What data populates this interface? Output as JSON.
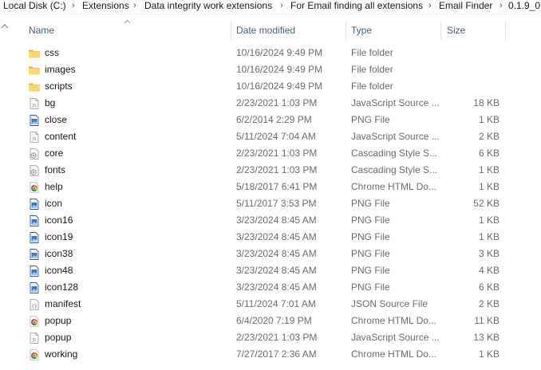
{
  "breadcrumb": {
    "items": [
      "Local Disk (C:)",
      "Extensions",
      "Data integrity work extensions",
      "For Email finding all extensions",
      "Email Finder",
      "0.1.9_0"
    ],
    "separator": "›"
  },
  "columns": {
    "name": "Name",
    "date": "Date modified",
    "type": "Type",
    "size": "Size"
  },
  "files": [
    {
      "name": "css",
      "date": "10/16/2024 9:49 PM",
      "type": "File folder",
      "size": "",
      "icon": "folder-icon"
    },
    {
      "name": "images",
      "date": "10/16/2024 9:49 PM",
      "type": "File folder",
      "size": "",
      "icon": "folder-icon"
    },
    {
      "name": "scripts",
      "date": "10/16/2024 9:49 PM",
      "type": "File folder",
      "size": "",
      "icon": "folder-icon"
    },
    {
      "name": "bg",
      "date": "2/23/2021 1:03 PM",
      "type": "JavaScript Source ...",
      "size": "18 KB",
      "icon": "js-file-icon"
    },
    {
      "name": "close",
      "date": "6/2/2014 2:29 PM",
      "type": "PNG File",
      "size": "1 KB",
      "icon": "png-file-icon"
    },
    {
      "name": "content",
      "date": "5/11/2024 7:04 AM",
      "type": "JavaScript Source ...",
      "size": "2 KB",
      "icon": "js-file-icon"
    },
    {
      "name": "core",
      "date": "2/23/2021 1:03 PM",
      "type": "Cascading Style S...",
      "size": "6 KB",
      "icon": "css-file-icon"
    },
    {
      "name": "fonts",
      "date": "2/23/2021 1:03 PM",
      "type": "Cascading Style S...",
      "size": "1 KB",
      "icon": "css-file-icon"
    },
    {
      "name": "help",
      "date": "5/18/2017 6:41 PM",
      "type": "Chrome HTML Do...",
      "size": "1 KB",
      "icon": "chrome-html-icon"
    },
    {
      "name": "icon",
      "date": "5/11/2017 3:53 PM",
      "type": "PNG File",
      "size": "52 KB",
      "icon": "png-file-icon"
    },
    {
      "name": "icon16",
      "date": "3/23/2024 8:45 AM",
      "type": "PNG File",
      "size": "1 KB",
      "icon": "png-file-icon"
    },
    {
      "name": "icon19",
      "date": "3/23/2024 8:45 AM",
      "type": "PNG File",
      "size": "1 KB",
      "icon": "png-file-icon"
    },
    {
      "name": "icon38",
      "date": "3/23/2024 8:45 AM",
      "type": "PNG File",
      "size": "3 KB",
      "icon": "png-file-icon"
    },
    {
      "name": "icon48",
      "date": "3/23/2024 8:45 AM",
      "type": "PNG File",
      "size": "4 KB",
      "icon": "png-file-icon"
    },
    {
      "name": "icon128",
      "date": "3/23/2024 8:45 AM",
      "type": "PNG File",
      "size": "6 KB",
      "icon": "png-file-icon"
    },
    {
      "name": "manifest",
      "date": "5/11/2024 7:01 AM",
      "type": "JSON Source File",
      "size": "2 KB",
      "icon": "json-file-icon"
    },
    {
      "name": "popup",
      "date": "6/4/2020 7:19 PM",
      "type": "Chrome HTML Do...",
      "size": "11 KB",
      "icon": "chrome-html-icon"
    },
    {
      "name": "popup",
      "date": "2/23/2021 1:03 PM",
      "type": "JavaScript Source ...",
      "size": "13 KB",
      "icon": "js-file-icon"
    },
    {
      "name": "working",
      "date": "7/27/2017 2:36 AM",
      "type": "Chrome HTML Do...",
      "size": "1 KB",
      "icon": "chrome-html-icon"
    }
  ],
  "colors": {
    "header_text": "#4c607a",
    "folder": "#f8d775",
    "secondary_text": "#6d6d6d"
  }
}
